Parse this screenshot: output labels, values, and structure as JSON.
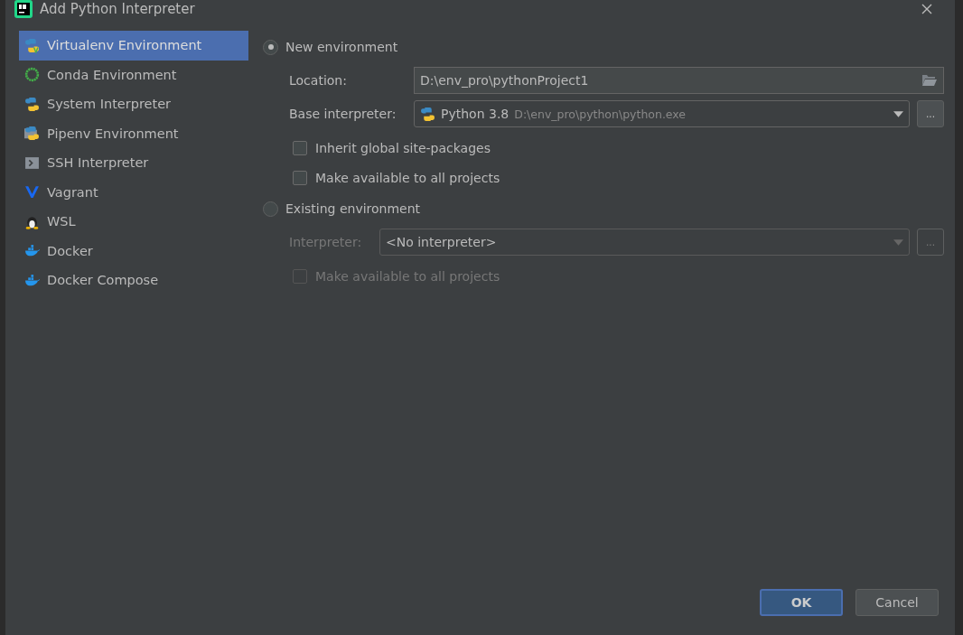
{
  "window": {
    "title": "Add Python Interpreter"
  },
  "sidebar": {
    "items": [
      {
        "label": "Virtualenv Environment",
        "kind": "virtualenv",
        "selected": true
      },
      {
        "label": "Conda Environment",
        "kind": "conda",
        "selected": false
      },
      {
        "label": "System Interpreter",
        "kind": "python",
        "selected": false
      },
      {
        "label": "Pipenv Environment",
        "kind": "pipenv",
        "selected": false
      },
      {
        "label": "SSH Interpreter",
        "kind": "ssh",
        "selected": false
      },
      {
        "label": "Vagrant",
        "kind": "vagrant",
        "selected": false
      },
      {
        "label": "WSL",
        "kind": "wsl",
        "selected": false
      },
      {
        "label": "Docker",
        "kind": "docker",
        "selected": false
      },
      {
        "label": "Docker Compose",
        "kind": "docker",
        "selected": false
      }
    ]
  },
  "new_environment": {
    "label": "New environment",
    "selected": true,
    "location": {
      "label": "Location:",
      "value": "D:\\env_pro\\pythonProject1"
    },
    "base_interpreter": {
      "label": "Base interpreter:",
      "name": "Python 3.8",
      "path": "D:\\env_pro\\python\\python.exe",
      "browse": "..."
    },
    "checkboxes": [
      {
        "label": "Inherit global site-packages",
        "checked": false,
        "disabled": false
      },
      {
        "label": "Make available to all projects",
        "checked": false,
        "disabled": false
      }
    ]
  },
  "existing_environment": {
    "label": "Existing environment",
    "selected": false,
    "interpreter": {
      "label": "Interpreter:",
      "value": "<No interpreter>",
      "browse": "...",
      "disabled": true
    },
    "checkboxes": [
      {
        "label": "Make available to all projects",
        "checked": false,
        "disabled": true
      }
    ]
  },
  "buttons": [
    {
      "label": "OK",
      "default": true
    },
    {
      "label": "Cancel",
      "default": false
    }
  ]
}
